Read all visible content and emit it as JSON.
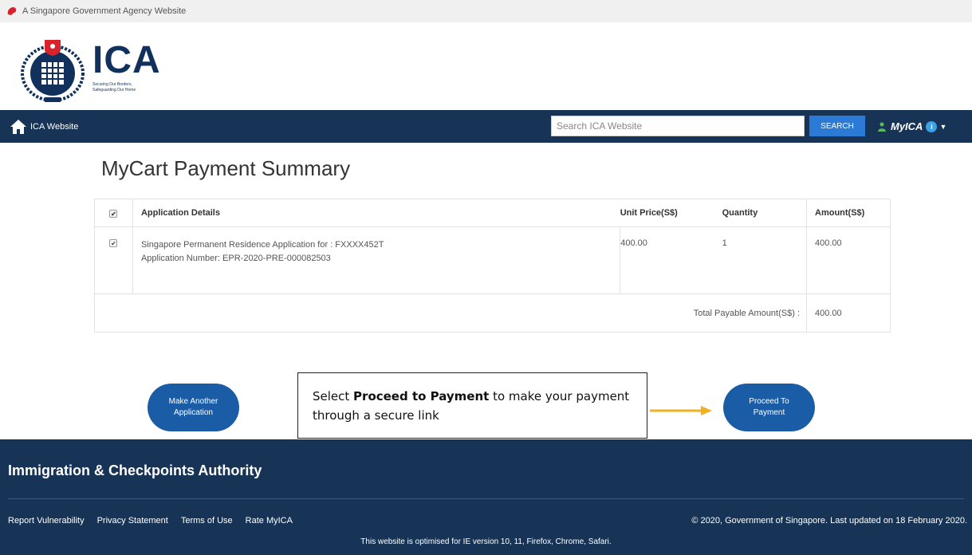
{
  "banner": {
    "text": "A Singapore Government Agency Website"
  },
  "logo": {
    "acronym": "ICA",
    "motto_line1": "Securing Our Borders,",
    "motto_line2": "Safeguarding Our Home"
  },
  "nav": {
    "home_label": "ICA Website",
    "search_placeholder": "Search ICA Website",
    "search_button": "SEARCH",
    "account_label": "MyICA",
    "info_badge": "i"
  },
  "page": {
    "title": "MyCart Payment Summary"
  },
  "table": {
    "headers": {
      "details": "Application Details",
      "unit_price": "Unit Price(S$)",
      "quantity": "Quantity",
      "amount": "Amount(S$)"
    },
    "rows": [
      {
        "line1": "Singapore Permanent Residence Application for : FXXXX452T",
        "line2": "Application Number: EPR-2020-PRE-000082503",
        "unit_price": "400.00",
        "quantity": "1",
        "amount": "400.00"
      }
    ],
    "total_label": "Total Payable Amount(S$) :",
    "total_amount": "400.00"
  },
  "buttons": {
    "make_another_line1": "Make Another",
    "make_another_line2": "Application",
    "proceed_line1": "Proceed To",
    "proceed_line2": "Payment"
  },
  "callout": {
    "prefix": "Select ",
    "bold": "Proceed to Payment",
    "suffix": " to make your payment through a secure link"
  },
  "footer": {
    "title": "Immigration & Checkpoints Authority",
    "links": [
      "Report Vulnerability",
      "Privacy Statement",
      "Terms of Use",
      "Rate MyICA"
    ],
    "copyright": "© 2020, Government of Singapore. Last updated on 18 February 2020.",
    "note": "This website is optimised for IE version 10, 11, Firefox, Chrome, Safari."
  },
  "colors": {
    "navy": "#173456",
    "button_blue": "#1a5da6",
    "search_blue": "#2a7ad6",
    "arrow_orange": "#f0b020",
    "banner_red": "#d8232a"
  }
}
